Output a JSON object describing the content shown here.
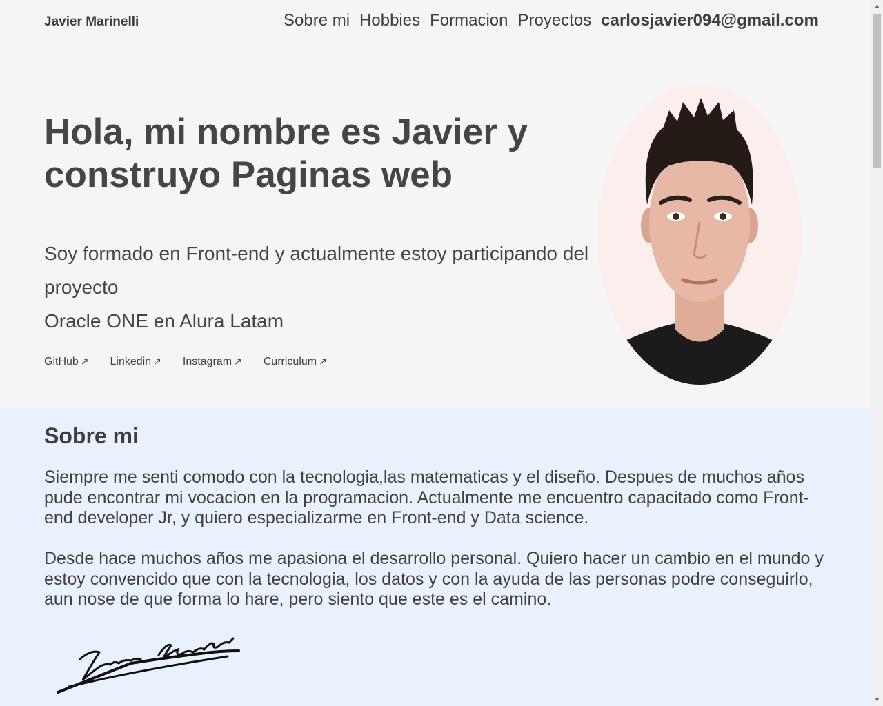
{
  "header": {
    "brand": "Javier Marinelli",
    "nav": [
      "Sobre mi",
      "Hobbies",
      "Formacion",
      "Proyectos"
    ],
    "email": "carlosjavier094@gmail.com"
  },
  "hero": {
    "title": "Hola, mi nombre es Javier y construyo Paginas web",
    "desc_line1": "Soy formado en Front-end y actualmente estoy participando del proyecto",
    "desc_line2": "Oracle ONE en Alura Latam",
    "links": [
      "GitHub",
      "Linkedin",
      "Instagram",
      "Curriculum"
    ],
    "link_arrow": "↗"
  },
  "about": {
    "title": "Sobre mi",
    "p1": "Siempre me senti comodo con la tecnologia,las matematicas y el diseño. Despues de muchos años pude encontrar mi vocacion en la programacion. Actualmente me encuentro capacitado como Front-end developer Jr, y quiero especializarme en Front-end y Data science.",
    "p2": "Desde hace muchos años me apasiona el desarrollo personal. Quiero hacer un cambio en el mundo y estoy convencido que con la tecnologia, los datos y con la ayuda de las personas podre conseguirlo, aun nose de que forma lo hare, pero siento que este es el camino.",
    "signature_text": "Javier Marinelli"
  },
  "colors": {
    "page_bg": "#f5f5f5",
    "about_bg": "#e9f1fc",
    "text": "#454545"
  }
}
